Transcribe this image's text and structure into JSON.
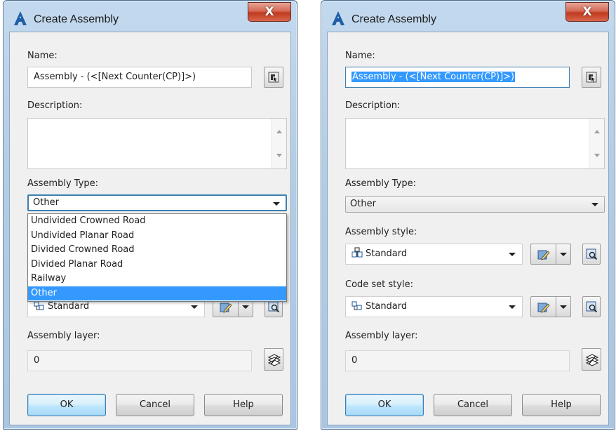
{
  "dialogs": [
    {
      "title": "Create Assembly",
      "close_label": "X",
      "name_label": "Name:",
      "name_value": "Assembly - (<[Next Counter(CP)]>)",
      "description_label": "Description:",
      "assembly_type_label": "Assembly Type:",
      "assembly_type_value": "Other",
      "assembly_type_options": [
        "Undivided Crowned Road",
        "Undivided Planar Road",
        "Divided Crowned Road",
        "Divided Planar Road",
        "Railway",
        "Other"
      ],
      "code_set_style_value": "Standard",
      "assembly_layer_label": "Assembly layer:",
      "assembly_layer_value": "0",
      "ok_label": "OK",
      "cancel_label": "Cancel",
      "help_label": "Help"
    },
    {
      "title": "Create Assembly",
      "close_label": "X",
      "name_label": "Name:",
      "name_value": "Assembly - (<[Next Counter(CP)]>)",
      "description_label": "Description:",
      "assembly_type_label": "Assembly Type:",
      "assembly_type_value": "Other",
      "assembly_style_label": "Assembly style:",
      "assembly_style_value": "Standard",
      "code_set_style_label": "Code set style:",
      "code_set_style_value": "Standard",
      "assembly_layer_label": "Assembly layer:",
      "assembly_layer_value": "0",
      "ok_label": "OK",
      "cancel_label": "Cancel",
      "help_label": "Help"
    }
  ],
  "colors": {
    "selection": "#3399ff",
    "title_gradient": "#b2cde6",
    "close_button": "#c0391f",
    "client_bg": "#f0f0f0"
  },
  "icons": [
    "autocad-a-icon",
    "pick-name-icon",
    "style-edit-icon",
    "style-preview-icon",
    "layer-icon",
    "assembly-style-icon",
    "code-set-style-icon"
  ]
}
